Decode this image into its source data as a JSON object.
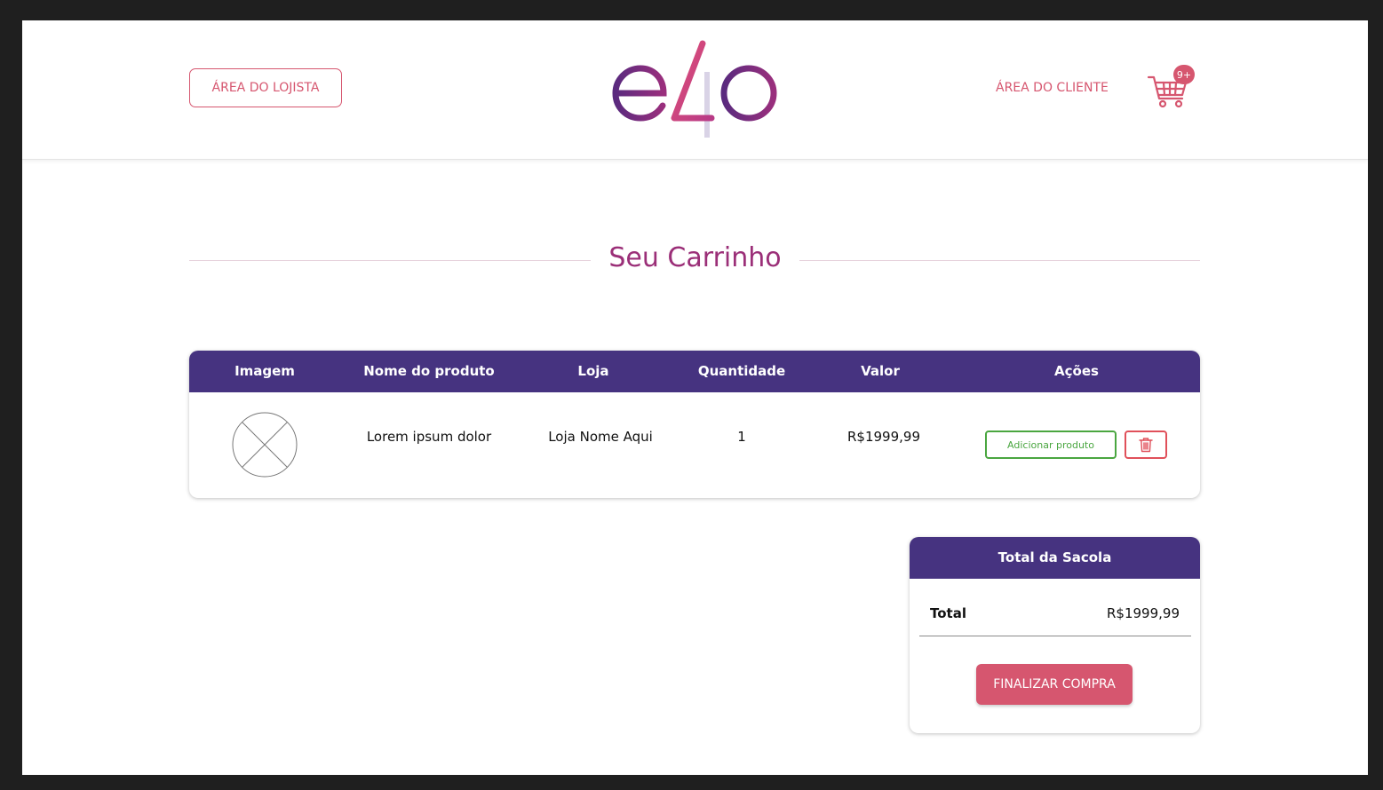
{
  "header": {
    "lojista_button": "ÁREA DO LOJISTA",
    "logo_text": "e4o",
    "cliente_link": "ÁREA DO CLIENTE",
    "cart_badge": "9+",
    "cart_icon": "shopping-cart-icon"
  },
  "main": {
    "title": "Seu Carrinho"
  },
  "table": {
    "columns": [
      "Imagem",
      "Nome do produto",
      "Loja",
      "Quantidade",
      "Valor",
      "Ações"
    ],
    "rows": [
      {
        "image_icon": "image-placeholder-icon",
        "name": "Lorem ipsum dolor",
        "store": "Loja Nome Aqui",
        "quantity": "1",
        "price": "R$1999,99",
        "add_button": "Adicionar produto",
        "delete_icon": "trash-icon"
      }
    ]
  },
  "summary": {
    "title": "Total da Sacola",
    "total_label": "Total",
    "total_value": "R$1999,99",
    "checkout_button": "FINALIZAR COMPRA"
  },
  "colors": {
    "brand_pink": "#d6566f",
    "brand_purple": "#463380",
    "title_magenta": "#9b2f78",
    "add_green": "#4aa640",
    "delete_red": "#e0505a"
  }
}
